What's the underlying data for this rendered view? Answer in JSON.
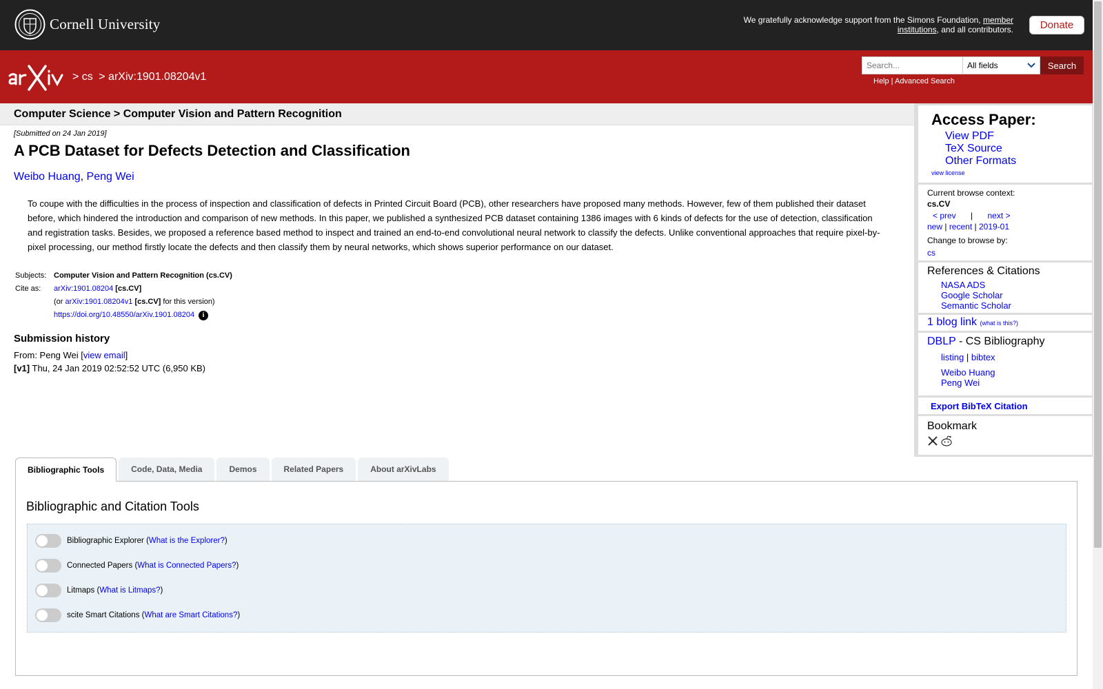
{
  "cornell": {
    "wordmark": "Cornell University",
    "support_prefix": "We gratefully acknowledge support from the Simons Foundation,",
    "support_link": "member institutions",
    "support_suffix": ", and all contributors.",
    "donate": "Donate"
  },
  "header": {
    "breadcrumb": [
      "> cs",
      "> arXiv:1901.08204v1"
    ],
    "search_placeholder": "Search...",
    "search_field": "All fields",
    "search_button": "Search",
    "help": "Help",
    "separator": " | ",
    "advanced": "Advanced Search"
  },
  "subheader": "Computer Science > Computer Vision and Pattern Recognition",
  "paper": {
    "submitted": "[Submitted on 24 Jan 2019]",
    "title": "A PCB Dataset for Defects Detection and Classification",
    "authors": [
      "Weibo Huang",
      "Peng Wei"
    ],
    "author_sep": ", ",
    "abstract": "To coupe with the difficulties in the process of inspection and classification of defects in Printed Circuit Board (PCB), other researchers have proposed many methods. However, few of them published their dataset before, which hindered the introduction and comparison of new methods. In this paper, we published a synthesized PCB dataset containing 1386 images with 6 kinds of defects for the use of detection, classification and registration tasks. Besides, we proposed a reference based method to inspect and trained an end-to-end convolutional neural network to classify the defects. Unlike conventional approaches that require pixel-by-pixel processing, our method firstly locate the defects and then classify them by neural networks, which shows superior performance on our dataset.",
    "subjects_label": "Subjects:",
    "subjects": "Computer Vision and Pattern Recognition (cs.CV)",
    "cite_label": "Cite as:",
    "cite_id": "arXiv:1901.08204",
    "cite_cat": "[cs.CV]",
    "cite_or": "(or",
    "cite_version_id": "arXiv:1901.08204v1",
    "cite_version_cat": "[cs.CV]",
    "cite_version_suffix": "for this version)",
    "doi": "https://doi.org/10.48550/arXiv.1901.08204",
    "info_icon": "i"
  },
  "history": {
    "title": "Submission history",
    "from_prefix": "From: Peng Wei [",
    "from_link": "view email",
    "from_suffix": "]",
    "v1_label": "[v1]",
    "v1_text": "Thu, 24 Jan 2019 02:52:52 UTC (6,950 KB)"
  },
  "sidebar": {
    "access_title": "Access Paper:",
    "access_links": [
      "View PDF",
      "TeX Source",
      "Other Formats"
    ],
    "view_license": "view license",
    "browse_label": "Current browse context:",
    "browse_context": "cs.CV",
    "prev": "< prev",
    "nav_sep": "|",
    "next": "next >",
    "new": "new",
    "recent": "recent",
    "month": "2019-01",
    "change_label": "Change to browse by:",
    "change_cs": "cs",
    "refs_title": "References & Citations",
    "refs_links": [
      "NASA ADS",
      "Google Scholar",
      "Semantic Scholar"
    ],
    "blog_link": "1 blog link",
    "blog_small": "(what is this?)",
    "dblp_link": "DBLP",
    "dblp_suffix": " - CS Bibliography",
    "dblp_listing": "listing",
    "dblp_bibtex": "bibtex",
    "dblp_authors": [
      "Weibo Huang",
      "Peng Wei"
    ],
    "export": "Export BibTeX Citation",
    "bookmark_title": "Bookmark"
  },
  "tabs": [
    "Bibliographic Tools",
    "Code, Data, Media",
    "Demos",
    "Related Papers",
    "About arXivLabs"
  ],
  "panel": {
    "title": "Bibliographic and Citation Tools",
    "tools": [
      {
        "label": "Bibliographic Explorer",
        "link": "What is the Explorer?"
      },
      {
        "label": "Connected Papers",
        "link": "What is Connected Papers?"
      },
      {
        "label": "Litmaps",
        "link": "What is Litmaps?"
      },
      {
        "label": "scite Smart Citations",
        "link": "What are Smart Citations?"
      }
    ]
  },
  "colors": {
    "arxiv_red": "#b31b1b",
    "cornell_dark": "#222222",
    "link_blue": "#0000ee"
  }
}
